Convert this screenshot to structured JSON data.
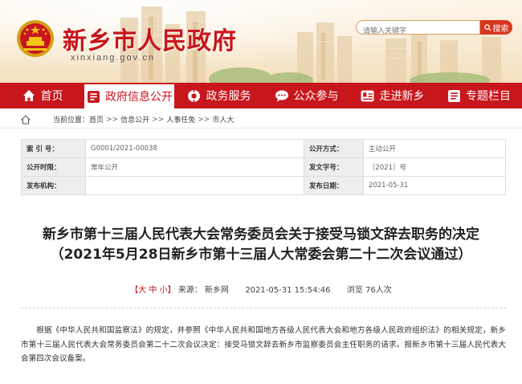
{
  "header": {
    "site_title": "新乡市人民政府",
    "domain": "xinxiang.gov.cn",
    "search_placeholder": "请输入关键字",
    "search_label": "搜索",
    "brand_color": "#c8161d"
  },
  "nav": {
    "items": [
      {
        "label": "首页",
        "icon": "home-icon"
      },
      {
        "label": "政府信息公开",
        "icon": "document-icon",
        "active": true
      },
      {
        "label": "政务服务",
        "icon": "service-icon"
      },
      {
        "label": "公众参与",
        "icon": "chat-icon"
      },
      {
        "label": "走进新乡",
        "icon": "card-icon"
      },
      {
        "label": "专题栏目",
        "icon": "folder-icon"
      }
    ]
  },
  "breadcrumb": {
    "prefix": "当前位置：",
    "items": [
      "首页",
      "信息公开",
      "人事任免",
      "市人大"
    ],
    "sep": ">>"
  },
  "info_table": {
    "rows": [
      {
        "k1": "索  引  号：",
        "v1": "G0001/2021-00038",
        "k2": "公开方式：",
        "v2": "主动公开"
      },
      {
        "k1": "公开时限：",
        "v1": "常年公开",
        "k2": "发文字号：",
        "v2": "〔2021〕号"
      },
      {
        "k1": "发布机构：",
        "v1": "",
        "k2": "发布日期：",
        "v2": "2021-05-31"
      }
    ]
  },
  "article": {
    "title_line1": "新乡市第十三届人民代表大会常务委员会关于接受马锁文辞去职务的决定",
    "title_line2": "（2021年5月28日新乡市第十三届人大常委会第二十二次会议通过）",
    "font_size_bracket_open": "【",
    "font_size_large": "大",
    "font_size_medium": "中",
    "font_size_small": "小",
    "font_size_bracket_close": "】",
    "source": "来源：  新乡网",
    "datetime": "2021-05-31 15:54:46",
    "views": "浏览 76人次",
    "body": "根据《中华人民共和国监察法》的规定，并参照《中华人民共和国地方各级人民代表大会和地方各级人民政府组织法》的相关规定，新乡市第十三届人民代表大会常务委员会第二十二次会议决定：接受马锁文辞去新乡市监察委员会主任职务的请求。报新乡市第十三届人民代表大会第四次会议备案。"
  }
}
